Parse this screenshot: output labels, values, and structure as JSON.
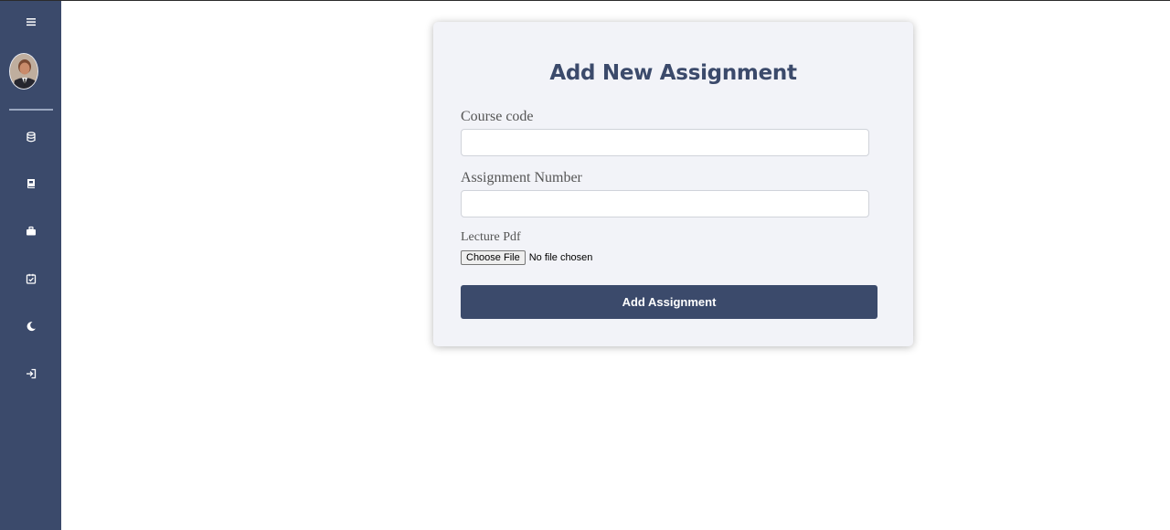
{
  "sidebar": {
    "items": [
      {
        "icon": "menu-icon"
      },
      {
        "icon": "database-icon"
      },
      {
        "icon": "book-icon"
      },
      {
        "icon": "briefcase-icon"
      },
      {
        "icon": "calendar-check-icon"
      },
      {
        "icon": "moon-icon"
      },
      {
        "icon": "logout-icon"
      }
    ]
  },
  "form": {
    "title": "Add New Assignment",
    "course_code": {
      "label": "Course code",
      "value": "",
      "placeholder": ""
    },
    "assignment_number": {
      "label": "Assignment Number",
      "value": "",
      "placeholder": ""
    },
    "lecture_pdf": {
      "label": "Lecture Pdf",
      "button_label": "Choose File",
      "status": "No file chosen"
    },
    "submit_label": "Add Assignment"
  },
  "colors": {
    "sidebar": "#3b4a6b",
    "accent": "#3b4a6b",
    "card_background": "#f2f3f8"
  }
}
